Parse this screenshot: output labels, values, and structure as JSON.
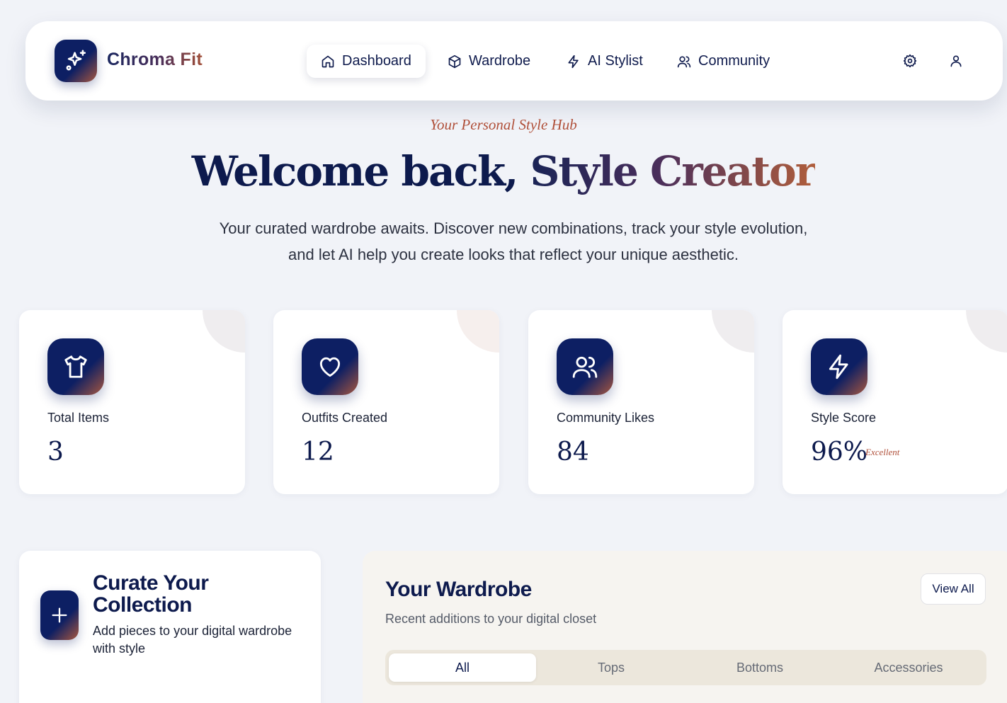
{
  "brand": {
    "name": "Chroma Fit",
    "logo_icon": "sparkles-icon"
  },
  "nav": {
    "items": [
      {
        "label": "Dashboard",
        "icon": "home-icon",
        "active": true
      },
      {
        "label": "Wardrobe",
        "icon": "box-icon",
        "active": false
      },
      {
        "label": "AI Stylist",
        "icon": "lightning-icon",
        "active": false
      },
      {
        "label": "Community",
        "icon": "users-icon",
        "active": false
      }
    ],
    "actions": [
      {
        "icon": "gear-icon"
      },
      {
        "icon": "user-icon"
      }
    ]
  },
  "hero": {
    "kicker": "Your Personal Style Hub",
    "title_part1": "Welcome back, ",
    "title_part2": "Style Creator",
    "subtitle": "Your curated wardrobe awaits. Discover new combinations, track your style evolution, and let AI help you create looks that reflect your unique aesthetic."
  },
  "stats": [
    {
      "label": "Total Items",
      "value": "3",
      "icon": "shirt-icon"
    },
    {
      "label": "Outfits Created",
      "value": "12",
      "icon": "heart-icon"
    },
    {
      "label": "Community Likes",
      "value": "84",
      "icon": "users-icon"
    },
    {
      "label": "Style Score",
      "value": "96%",
      "tag": "Excellent",
      "icon": "lightning-icon"
    }
  ],
  "curate": {
    "title": "Curate Your Collection",
    "text": "Add pieces to your digital wardrobe with style",
    "icon": "plus-icon"
  },
  "wardrobe": {
    "title": "Your Wardrobe",
    "description": "Recent additions to your digital closet",
    "view_all": "View All",
    "tabs": [
      "All",
      "Tops",
      "Bottoms",
      "Accessories"
    ],
    "active_tab": "All"
  },
  "colors": {
    "navy": "#0d1f63",
    "accent": "#b0503a",
    "background": "#f1f3f8"
  }
}
